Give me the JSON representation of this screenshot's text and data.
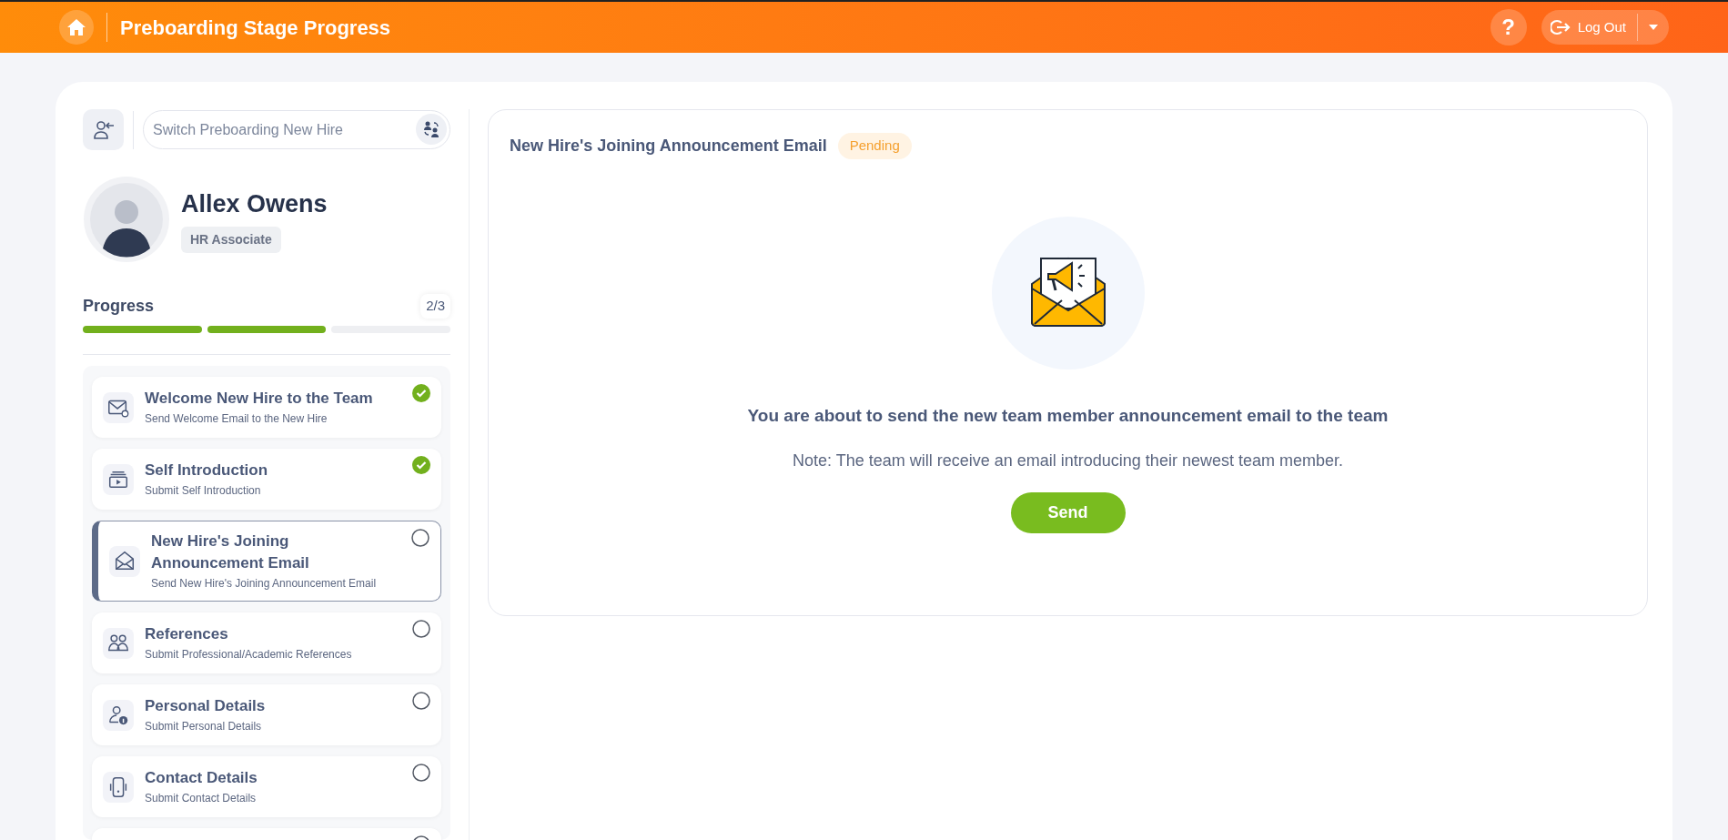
{
  "header": {
    "title": "Preboarding Stage Progress",
    "help": "?",
    "logout": "Log Out"
  },
  "sidebar": {
    "search": {
      "placeholder": "Switch Preboarding New Hire"
    },
    "profile": {
      "name": "Allex Owens",
      "role": "HR Associate"
    },
    "progress": {
      "label": "Progress",
      "count": "2/3",
      "segments": [
        {
          "filled": true
        },
        {
          "filled": true
        },
        {
          "filled": false
        }
      ]
    },
    "steps": [
      {
        "kind": "email",
        "title": "Welcome New Hire to the Team",
        "subtitle": "Send Welcome Email to the New Hire",
        "done": true,
        "selected": false
      },
      {
        "kind": "video",
        "title": "Self Introduction",
        "subtitle": "Submit Self Introduction",
        "done": true,
        "selected": false
      },
      {
        "kind": "envelope",
        "title": "New Hire's Joining Announcement Email",
        "subtitle": "Send New Hire's Joining Announcement Email",
        "done": false,
        "selected": true
      },
      {
        "kind": "people",
        "title": "References",
        "subtitle": "Submit Professional/Academic References",
        "done": false,
        "selected": false
      },
      {
        "kind": "person",
        "title": "Personal Details",
        "subtitle": "Submit Personal Details",
        "done": false,
        "selected": false
      },
      {
        "kind": "phone",
        "title": "Contact Details",
        "subtitle": "Submit Contact Details",
        "done": false,
        "selected": false
      },
      {
        "kind": "blank",
        "done": false,
        "selected": false
      }
    ]
  },
  "panel": {
    "title": "New Hire's Joining Announcement Email",
    "status": "Pending",
    "message": "You are about to send the new team member announcement email to the team",
    "note": "Note: The team will receive an email introducing their newest team member.",
    "button": "Send"
  }
}
